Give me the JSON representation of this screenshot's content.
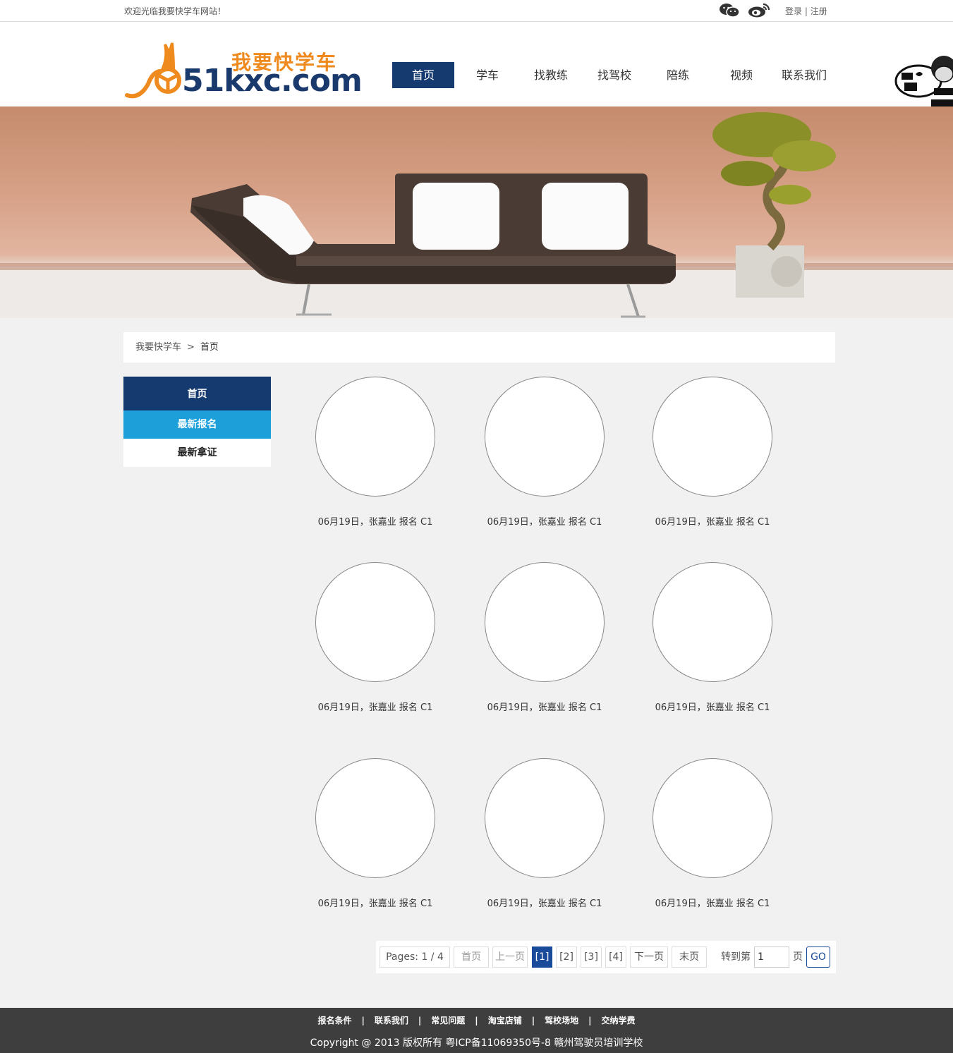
{
  "topbar": {
    "welcome": "欢迎光临我要快学车网站！",
    "login": "登录",
    "divider": "|",
    "register": "注册",
    "icons": [
      "wechat-icon",
      "weibo-icon"
    ]
  },
  "logo": {
    "cn": "我要快学车",
    "en": "51kxc.com"
  },
  "nav": [
    "首页",
    "学车",
    "找教练",
    "找驾校",
    "陪练",
    "视频",
    "联系我们"
  ],
  "nav_active": "首页",
  "breadcrumb": {
    "root": "我要快学车",
    "sep": ">",
    "current": "首页"
  },
  "side": {
    "title": "首页",
    "items": [
      "最新报名",
      "最新拿证"
    ]
  },
  "cards": [
    "06月19日，张嘉业 报名  C1",
    "06月19日，张嘉业 报名  C1",
    "06月19日，张嘉业 报名  C1",
    "06月19日，张嘉业 报名  C1",
    "06月19日，张嘉业 报名  C1",
    "06月19日，张嘉业 报名  C1",
    "06月19日，张嘉业 报名  C1",
    "06月19日，张嘉业 报名  C1",
    "06月19日，张嘉业 报名  C1"
  ],
  "pager": {
    "pages": "Pages: 1 / 4",
    "first": "首页",
    "prev": "上一页",
    "p1": "[1]",
    "p2": "[2]",
    "p3": "[3]",
    "p4": "[4]",
    "next": "下一页",
    "last": "末页",
    "goto": "转到第",
    "goto_value": "1",
    "unit": "页",
    "go": "GO"
  },
  "footer": {
    "links": [
      "报名条件",
      "联系我们",
      "常见问题",
      "淘宝店铺",
      "驾校场地",
      "交纳学费"
    ],
    "sep": "|",
    "copyright": "Copyright @ 2013 版权所有 粤ICP备11069350号-8   赣州驾驶员培训学校"
  },
  "colors": {
    "nav_active": "#153a70",
    "side_selected": "#1da0da",
    "logo_orange": "#ef8a1e",
    "logo_blue": "#1a3a6e",
    "footer_bg": "#3e3e3e"
  }
}
